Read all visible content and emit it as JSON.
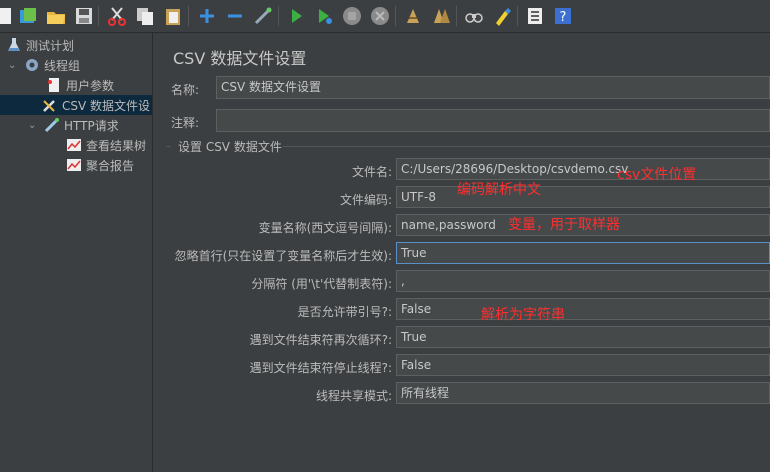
{
  "toolbar": {
    "icons": [
      "new-icon",
      "templates-icon",
      "open-icon",
      "save-icon",
      "cut-icon",
      "copy-icon",
      "paste-icon",
      "expand-icon",
      "collapse-icon",
      "toggle-icon",
      "start-icon",
      "start-no-pause-icon",
      "stop-icon",
      "shutdown-icon",
      "clear-icon",
      "clear-all-icon",
      "search-icon",
      "reset-search-icon",
      "function-helper-icon",
      "help-icon"
    ]
  },
  "tree": {
    "test_plan": "测试计划",
    "thread_group": "线程组",
    "user_params": "用户参数",
    "csv_config": "CSV 数据文件设",
    "http_request": "HTTP请求",
    "view_results_tree": "查看结果树",
    "aggregate_report": "聚合报告"
  },
  "panel": {
    "title": "CSV 数据文件设置",
    "name_label": "名称:",
    "name_value": "CSV 数据文件设置",
    "comment_label": "注释:",
    "comment_value": "",
    "group_title": "设置 CSV 数据文件",
    "rows": [
      {
        "label": "文件名:",
        "value": "C:/Users/28696/Desktop/csvdemo.csv"
      },
      {
        "label": "文件编码:",
        "value": "UTF-8"
      },
      {
        "label": "变量名称(西文逗号间隔):",
        "value": "name,password"
      },
      {
        "label": "忽略首行(只在设置了变量名称后才生效):",
        "value": "True"
      },
      {
        "label": "分隔符 (用'\\t'代替制表符):",
        "value": ","
      },
      {
        "label": "是否允许带引号?:",
        "value": "False"
      },
      {
        "label": "遇到文件结束符再次循环?:",
        "value": "True"
      },
      {
        "label": "遇到文件结束符停止线程?:",
        "value": "False"
      },
      {
        "label": "线程共享模式:",
        "value": "所有线程"
      }
    ]
  },
  "annotations": {
    "file_location": "csv文件位置",
    "encoding_note": "编码解析中文",
    "variables_note": "变量，用于取样器",
    "quote_note": "解析为字符串"
  },
  "colors": {
    "background": "#3c3f41",
    "field": "#45494a",
    "annotation": "#ff2f2f",
    "selection": "#0d293e"
  }
}
